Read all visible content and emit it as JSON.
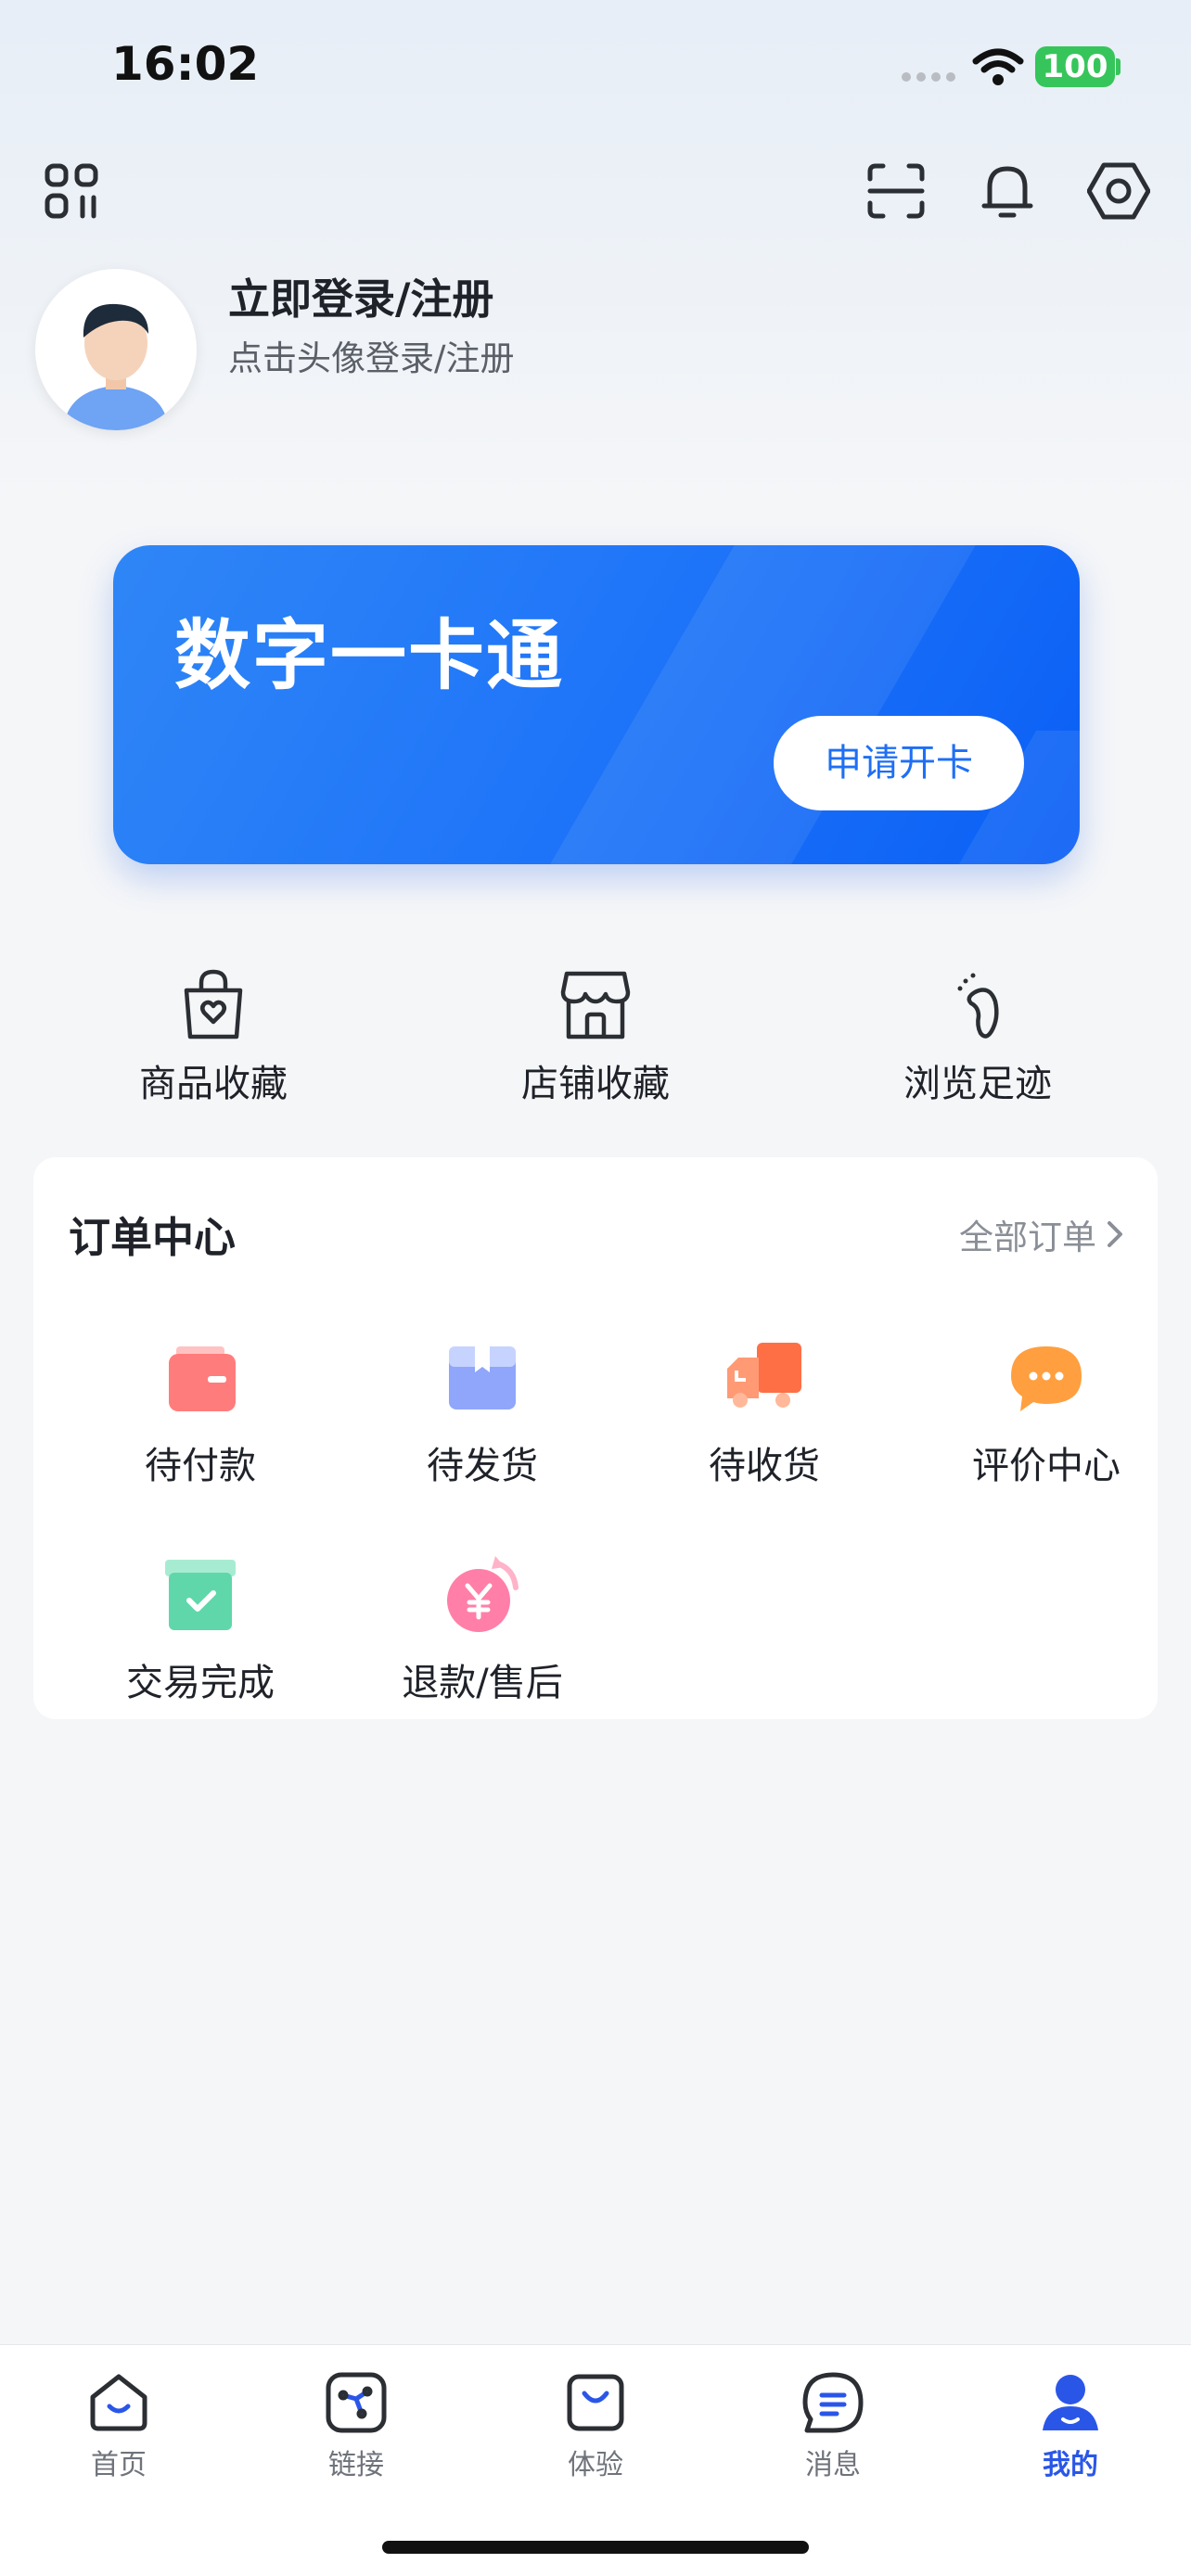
{
  "status_bar": {
    "time": "16:02",
    "battery": "100"
  },
  "profile": {
    "title": "立即登录/注册",
    "subtitle": "点击头像登录/注册"
  },
  "card": {
    "title": "数字一卡通",
    "button": "申请开卡"
  },
  "shortcuts": [
    {
      "label": "商品收藏",
      "icon": "bag-heart-icon"
    },
    {
      "label": "店铺收藏",
      "icon": "store-icon"
    },
    {
      "label": "浏览足迹",
      "icon": "footprint-icon"
    }
  ],
  "orders": {
    "title": "订单中心",
    "all_label": "全部订单",
    "items": [
      {
        "label": "待付款",
        "icon": "wallet-icon"
      },
      {
        "label": "待发货",
        "icon": "package-icon"
      },
      {
        "label": "待收货",
        "icon": "truck-icon"
      },
      {
        "label": "评价中心",
        "icon": "chat-bubble-icon"
      },
      {
        "label": "交易完成",
        "icon": "box-check-icon"
      },
      {
        "label": "退款/售后",
        "icon": "refund-icon"
      }
    ]
  },
  "tabbar": {
    "items": [
      {
        "label": "首页",
        "icon": "home-icon"
      },
      {
        "label": "链接",
        "icon": "link-icon"
      },
      {
        "label": "体验",
        "icon": "shopping-bag-icon"
      },
      {
        "label": "消息",
        "icon": "message-icon"
      },
      {
        "label": "我的",
        "icon": "profile-icon"
      }
    ],
    "active": "我的"
  },
  "colors": {
    "accent": "#2a56e8",
    "card_blue": "#1f75f8",
    "battery_green": "#36c55a"
  }
}
